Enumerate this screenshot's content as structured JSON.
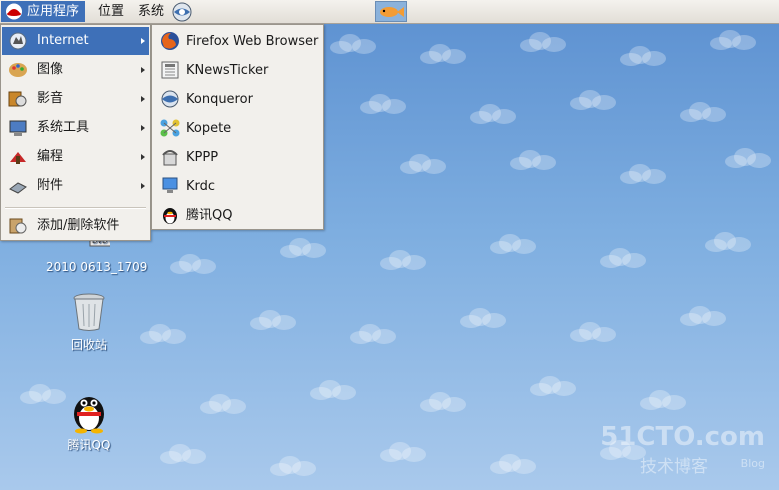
{
  "top_panel": {
    "applications_label": "应用程序",
    "places_label": "位置",
    "system_label": "系统"
  },
  "apps_menu": {
    "items": [
      {
        "label": "Internet",
        "icon": "internet-icon"
      },
      {
        "label": "图像",
        "icon": "graphics-icon"
      },
      {
        "label": "影音",
        "icon": "multimedia-icon"
      },
      {
        "label": "系统工具",
        "icon": "system-tools-icon"
      },
      {
        "label": "编程",
        "icon": "programming-icon"
      },
      {
        "label": "附件",
        "icon": "accessories-icon"
      }
    ],
    "add_remove_label": "添加/删除软件"
  },
  "internet_submenu": {
    "items": [
      {
        "label": "Firefox Web Browser",
        "icon": "firefox-icon"
      },
      {
        "label": "KNewsTicker",
        "icon": "news-icon"
      },
      {
        "label": "Konqueror",
        "icon": "konqueror-icon"
      },
      {
        "label": "Kopete",
        "icon": "kopete-icon"
      },
      {
        "label": "KPPP",
        "icon": "kppp-icon"
      },
      {
        "label": "Krdc",
        "icon": "krdc-icon"
      },
      {
        "label": "腾讯QQ",
        "icon": "qq-icon"
      }
    ]
  },
  "desktop": {
    "dvd_label": "2010 0613_1709",
    "trash_label": "回收站",
    "qq_label": "腾讯QQ"
  },
  "watermark": {
    "site": "51CTO.com",
    "sub": "技术博客",
    "blog": "Blog"
  },
  "colors": {
    "highlight": "#3e70b8",
    "menu_bg": "#f2f0ec",
    "desktop_sky": "#6f9fd6"
  }
}
